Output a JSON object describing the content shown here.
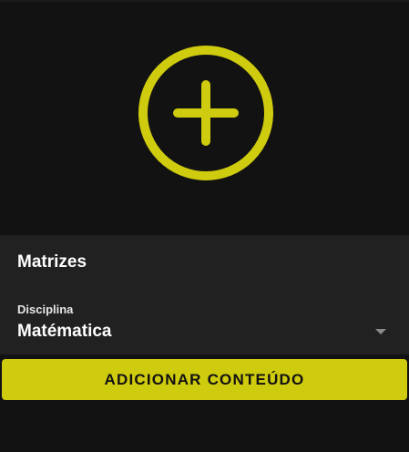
{
  "card": {
    "title": "Matrizes",
    "add_icon": "plus-circle-icon",
    "accent_color": "#cfcb0f"
  },
  "discipline": {
    "label": "Disciplina",
    "value": "Matématica",
    "icon": "dropdown-arrow-icon"
  },
  "actions": {
    "add_content_label": "ADICIONAR CONTEÚDO"
  }
}
